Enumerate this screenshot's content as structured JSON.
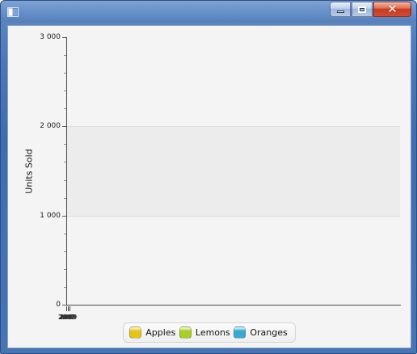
{
  "window": {
    "title": "",
    "controls": {
      "minimize_icon": "minimize-icon",
      "maximize_icon": "maximize-icon",
      "close_icon": "close-icon"
    }
  },
  "chart_data": {
    "type": "bar",
    "title": "",
    "xlabel": "",
    "ylabel": "Units Sold",
    "ylim": [
      0,
      3000
    ],
    "grid": true,
    "legend": "bottom-center",
    "y_ticks": [
      "0",
      "1 000",
      "2 000",
      "3 000"
    ],
    "categories": [
      "2007",
      "2008",
      "2009"
    ],
    "series": [
      {
        "name": "Apples",
        "color": "#e6c419",
        "values": [
          0,
          0,
          0
        ]
      },
      {
        "name": "Lemons",
        "color": "#a9cf22",
        "values": [
          0,
          0,
          0
        ]
      },
      {
        "name": "Oranges",
        "color": "#35a9d2",
        "values": [
          0,
          0,
          0
        ]
      }
    ]
  }
}
